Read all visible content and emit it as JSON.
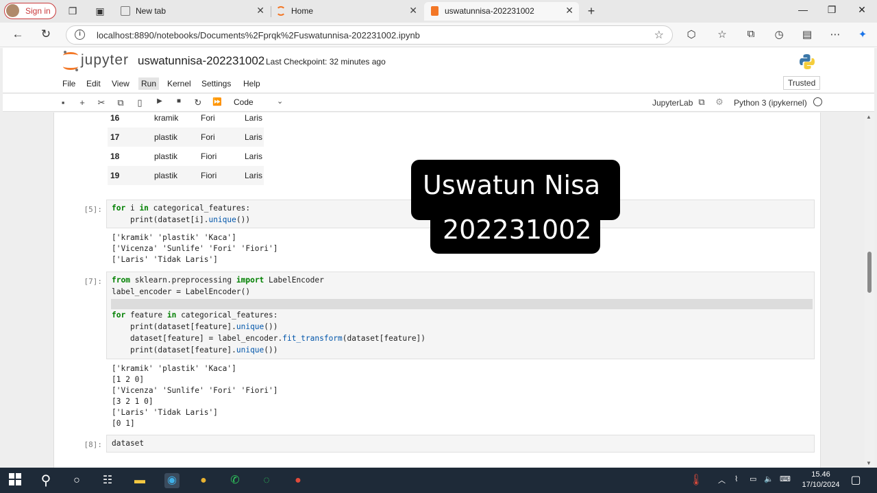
{
  "browser": {
    "signin_label": "Sign in",
    "tabs": [
      {
        "title": "New tab"
      },
      {
        "title": "Home"
      },
      {
        "title": "uswatunnisa-202231002"
      }
    ],
    "url": "localhost:8890/notebooks/Documents%2Fprqk%2Fuswatunnisa-202231002.ipynb"
  },
  "jupyter": {
    "logo_text": "jupyter",
    "notebook_name": "uswatunnisa-202231002",
    "checkpoint": "Last Checkpoint: 32 minutes ago",
    "menu": [
      "File",
      "Edit",
      "View",
      "Run",
      "Kernel",
      "Settings",
      "Help"
    ],
    "trusted": "Trusted",
    "cell_type": "Code",
    "jupyterlab_label": "JupyterLab",
    "kernel": "Python 3 (ipykernel)"
  },
  "dataframe_rows": [
    {
      "idx": "16",
      "c1": "kramik",
      "c2": "Fori",
      "c3": "Laris"
    },
    {
      "idx": "17",
      "c1": "plastik",
      "c2": "Fori",
      "c3": "Laris"
    },
    {
      "idx": "18",
      "c1": "plastik",
      "c2": "Fiori",
      "c3": "Laris"
    },
    {
      "idx": "19",
      "c1": "plastik",
      "c2": "Fiori",
      "c3": "Laris"
    }
  ],
  "cells": {
    "c5": {
      "prompt": "[5]:",
      "outputs": [
        "['kramik' 'plastik' 'Kaca']",
        "['Vicenza' 'Sunlife' 'Fori' 'Fiori']",
        "['Laris' 'Tidak Laris']"
      ]
    },
    "c7": {
      "prompt": "[7]:",
      "outputs": [
        "['kramik' 'plastik' 'Kaca']",
        "[1 2 0]",
        "['Vicenza' 'Sunlife' 'Fori' 'Fiori']",
        "[3 2 1 0]",
        "['Laris' 'Tidak Laris']",
        "[0 1]"
      ]
    },
    "c8": {
      "prompt": "[8]:",
      "code": "dataset"
    }
  },
  "watermark": {
    "line1": "Uswatun Nisa",
    "line2": "202231002"
  },
  "taskbar": {
    "time": "15.46",
    "date": "17/10/2024"
  },
  "colors": {
    "jupyter_orange": "#f37726",
    "keyword_green": "#008000",
    "taskbar_bg": "#1e2a38"
  }
}
